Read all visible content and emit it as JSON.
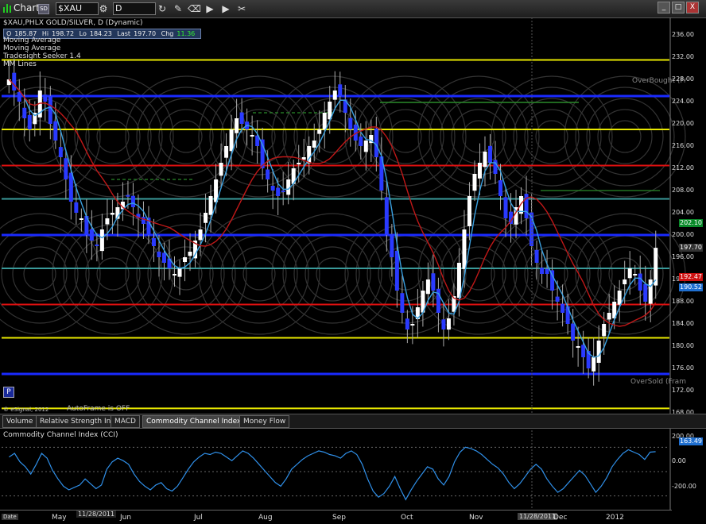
{
  "window": {
    "title": "Chart",
    "badge": "SD",
    "symbol": "$XAU",
    "interval": "D",
    "tool_icons": [
      "refresh-icon",
      "pencil-icon",
      "eraser-icon",
      "play-icon",
      "play-icon",
      "wrench-icon"
    ],
    "window_buttons": [
      "_",
      "□",
      "X"
    ]
  },
  "header": {
    "name_line": "$XAU,PHLX GOLD/SILVER, D (Dynamic)",
    "ohlc": {
      "o_label": "O",
      "o": "185.87",
      "h_label": "Hi",
      "h": "198.72",
      "l_label": "Lo",
      "l": "184.23",
      "last_label": "Last",
      "last": "197.70",
      "chg_label": "Chg",
      "chg": "11.36"
    },
    "studies": [
      "Moving Average",
      "Moving Average",
      "Tradesight Seeker 1.4",
      "MM Lines"
    ]
  },
  "chart_labels": {
    "overbought": "OverBought (Fr",
    "oversold": "OverSold (Fram",
    "autoframe": "AutoFrame is OFF",
    "copyright": "© eSignal, 2012",
    "p_button": "P"
  },
  "price_axis": {
    "ticks": [
      "236.00",
      "232.00",
      "228.00",
      "224.00",
      "220.00",
      "216.00",
      "212.00",
      "208.00",
      "204.00",
      "200.00",
      "196.00",
      "192.00",
      "188.00",
      "184.00",
      "180.00",
      "176.00",
      "172.00",
      "168.00"
    ],
    "tags": [
      {
        "value": "202.10",
        "color": "#0a8a2a"
      },
      {
        "value": "197.70",
        "color": "#333333"
      },
      {
        "value": "192.47",
        "color": "#cc1111"
      },
      {
        "value": "190.52",
        "color": "#1f6fd0"
      }
    ]
  },
  "tabs": [
    "Volume",
    "Relative Strength Index",
    "MACD",
    "Commodity Channel Index (CCI)",
    "Money Flow"
  ],
  "cci_panel": {
    "label": "Commodity Channel Index (CCI)",
    "ticks": [
      "200.00",
      "0.00",
      "-200.00"
    ],
    "tag": "163.49"
  },
  "date_axis": {
    "left_tag": "Date",
    "cursor_date_left": "11/28/2011",
    "cursor_date_mid": "11/28/2011",
    "months": [
      "May",
      "Jun",
      "Jul",
      "Aug",
      "Sep",
      "Oct",
      "Nov",
      "Dec",
      "2012"
    ]
  },
  "chart_data": {
    "type": "candlestick",
    "title": "$XAU,PHLX GOLD/SILVER, D (Dynamic)",
    "ylim": [
      168,
      238
    ],
    "horizontal_lines": [
      {
        "price": 231.5,
        "color": "#e8e800"
      },
      {
        "price": 225.0,
        "color": "#1a2aff",
        "label": "OverBought"
      },
      {
        "price": 219.0,
        "color": "#e8e800"
      },
      {
        "price": 212.5,
        "color": "#e01010"
      },
      {
        "price": 206.5,
        "color": "#3a9a9a"
      },
      {
        "price": 200.0,
        "color": "#1a2aff"
      },
      {
        "price": 194.0,
        "color": "#3a9a9a"
      },
      {
        "price": 187.5,
        "color": "#e01010"
      },
      {
        "price": 181.5,
        "color": "#e8e800"
      },
      {
        "price": 175.0,
        "color": "#1a2aff",
        "label": "OverSold"
      },
      {
        "price": 168.8,
        "color": "#e8e800"
      }
    ],
    "closes": [
      228,
      226,
      224,
      221,
      219,
      222,
      226,
      224,
      220,
      217,
      214,
      210,
      206,
      204,
      203,
      200,
      199,
      198,
      201,
      203,
      204,
      205,
      206,
      207,
      205,
      203,
      202,
      200,
      198,
      196,
      195,
      194,
      193,
      194,
      196,
      197,
      199,
      201,
      204,
      207,
      210,
      213,
      216,
      219,
      221,
      220,
      219,
      218,
      216,
      212,
      210,
      208,
      207,
      208,
      210,
      212,
      213,
      214,
      216,
      217,
      219,
      222,
      224,
      226,
      225,
      222,
      219,
      217,
      216,
      217,
      218,
      214,
      208,
      200,
      196,
      190,
      186,
      183,
      184,
      187,
      190,
      192,
      190,
      186,
      183,
      185,
      189,
      195,
      201,
      207,
      211,
      213,
      215,
      213,
      211,
      207,
      203,
      202,
      205,
      207,
      203,
      198,
      195,
      193,
      193,
      190,
      188,
      186,
      184,
      181,
      180,
      178,
      176,
      178,
      181,
      184,
      186,
      188,
      190,
      192,
      194,
      193,
      190,
      188,
      192,
      197.7
    ],
    "cci_values": [
      120,
      150,
      80,
      40,
      -20,
      60,
      150,
      110,
      10,
      -60,
      -120,
      -150,
      -130,
      -110,
      -60,
      -100,
      -140,
      -110,
      20,
      80,
      110,
      90,
      60,
      -20,
      -80,
      -120,
      -150,
      -110,
      -90,
      -140,
      -160,
      -120,
      -50,
      20,
      80,
      120,
      150,
      140,
      160,
      150,
      120,
      90,
      130,
      170,
      150,
      110,
      60,
      10,
      -40,
      -90,
      -120,
      -60,
      20,
      60,
      100,
      130,
      150,
      170,
      160,
      140,
      130,
      110,
      150,
      170,
      140,
      60,
      -60,
      -160,
      -210,
      -180,
      -120,
      -40,
      -140,
      -230,
      -150,
      -80,
      -20,
      40,
      20,
      -60,
      -110,
      -40,
      80,
      160,
      200,
      190,
      170,
      140,
      100,
      60,
      30,
      -20,
      -90,
      -140,
      -100,
      -40,
      20,
      60,
      20,
      -60,
      -120,
      -170,
      -140,
      -90,
      -40,
      10,
      -30,
      -100,
      -170,
      -120,
      -50,
      40,
      100,
      150,
      180,
      160,
      140,
      100,
      160,
      163.49
    ],
    "months": [
      "May",
      "Jun",
      "Jul",
      "Aug",
      "Sep",
      "Oct",
      "Nov",
      "Dec",
      "2012"
    ]
  }
}
